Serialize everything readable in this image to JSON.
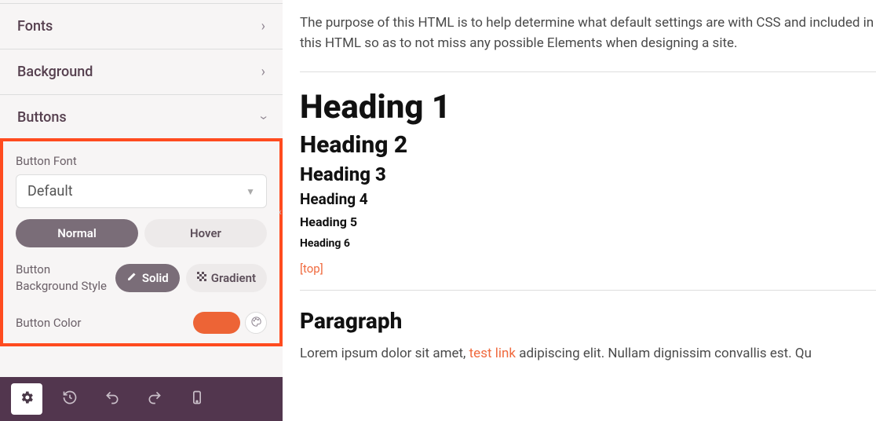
{
  "sidebar": {
    "sections": {
      "fonts": "Fonts",
      "background": "Background",
      "buttons": "Buttons"
    },
    "buttons_panel": {
      "font_label": "Button Font",
      "font_value": "Default",
      "state_tabs": {
        "normal": "Normal",
        "hover": "Hover"
      },
      "bg_style_label": "Button Background Style",
      "bg_style_options": {
        "solid": "Solid",
        "gradient": "Gradient"
      },
      "color_label": "Button Color",
      "color_value": "#ed6436"
    }
  },
  "content": {
    "intro": "The purpose of this HTML is to help determine what default settings are with CSS and included in this HTML so as to not miss any possible Elements when designing a site.",
    "headings": {
      "h1": "Heading 1",
      "h2": "Heading 2",
      "h3": "Heading 3",
      "h4": "Heading 4",
      "h5": "Heading 5",
      "h6": "Heading 6"
    },
    "top_link": "[top]",
    "paragraph_title": "Paragraph",
    "paragraph_body_pre": "Lorem ipsum dolor sit amet, ",
    "paragraph_link": "test link",
    "paragraph_body_post": " adipiscing elit. Nullam dignissim convallis est. Qu"
  }
}
